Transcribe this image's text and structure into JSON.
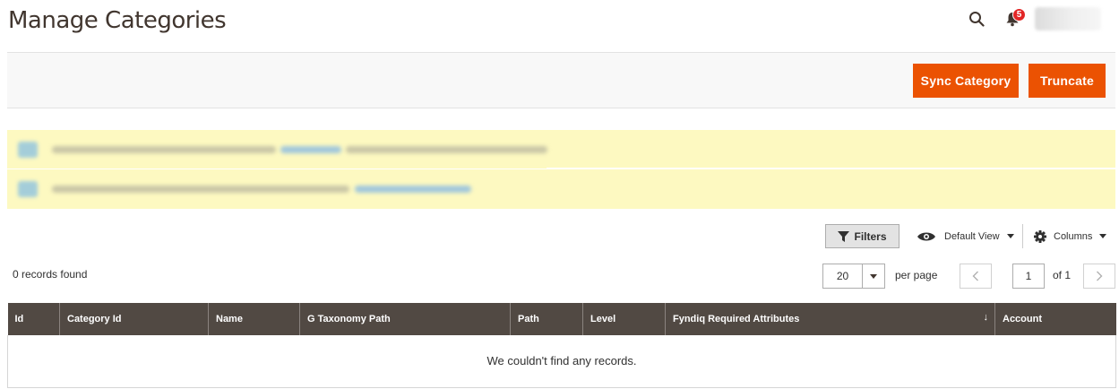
{
  "header": {
    "title": "Manage Categories",
    "notification_count": "5"
  },
  "actions": {
    "sync_label": "Sync Category",
    "truncate_label": "Truncate"
  },
  "toolbar": {
    "filters_label": "Filters",
    "view_label": "Default View",
    "columns_label": "Columns"
  },
  "records_found": "0 records found",
  "pagination": {
    "per_page_value": "20",
    "per_page_label": "per page",
    "current_page": "1",
    "page_of": "of 1"
  },
  "grid": {
    "columns": [
      "Id",
      "Category Id",
      "Name",
      "G Taxonomy Path",
      "Path",
      "Level",
      "Fyndiq Required Attributes",
      "Account"
    ],
    "empty_message": "We couldn't find any records."
  },
  "colors": {
    "accent": "#eb5202",
    "header_bg": "#514943",
    "notice_bg": "#fdf9c1",
    "badge": "#e22626"
  },
  "icons": [
    "search-icon",
    "bell-icon",
    "filter-icon",
    "eye-icon",
    "gear-icon",
    "chevron-left-icon",
    "chevron-right-icon",
    "caret-down-icon",
    "sort-arrow-icon"
  ]
}
